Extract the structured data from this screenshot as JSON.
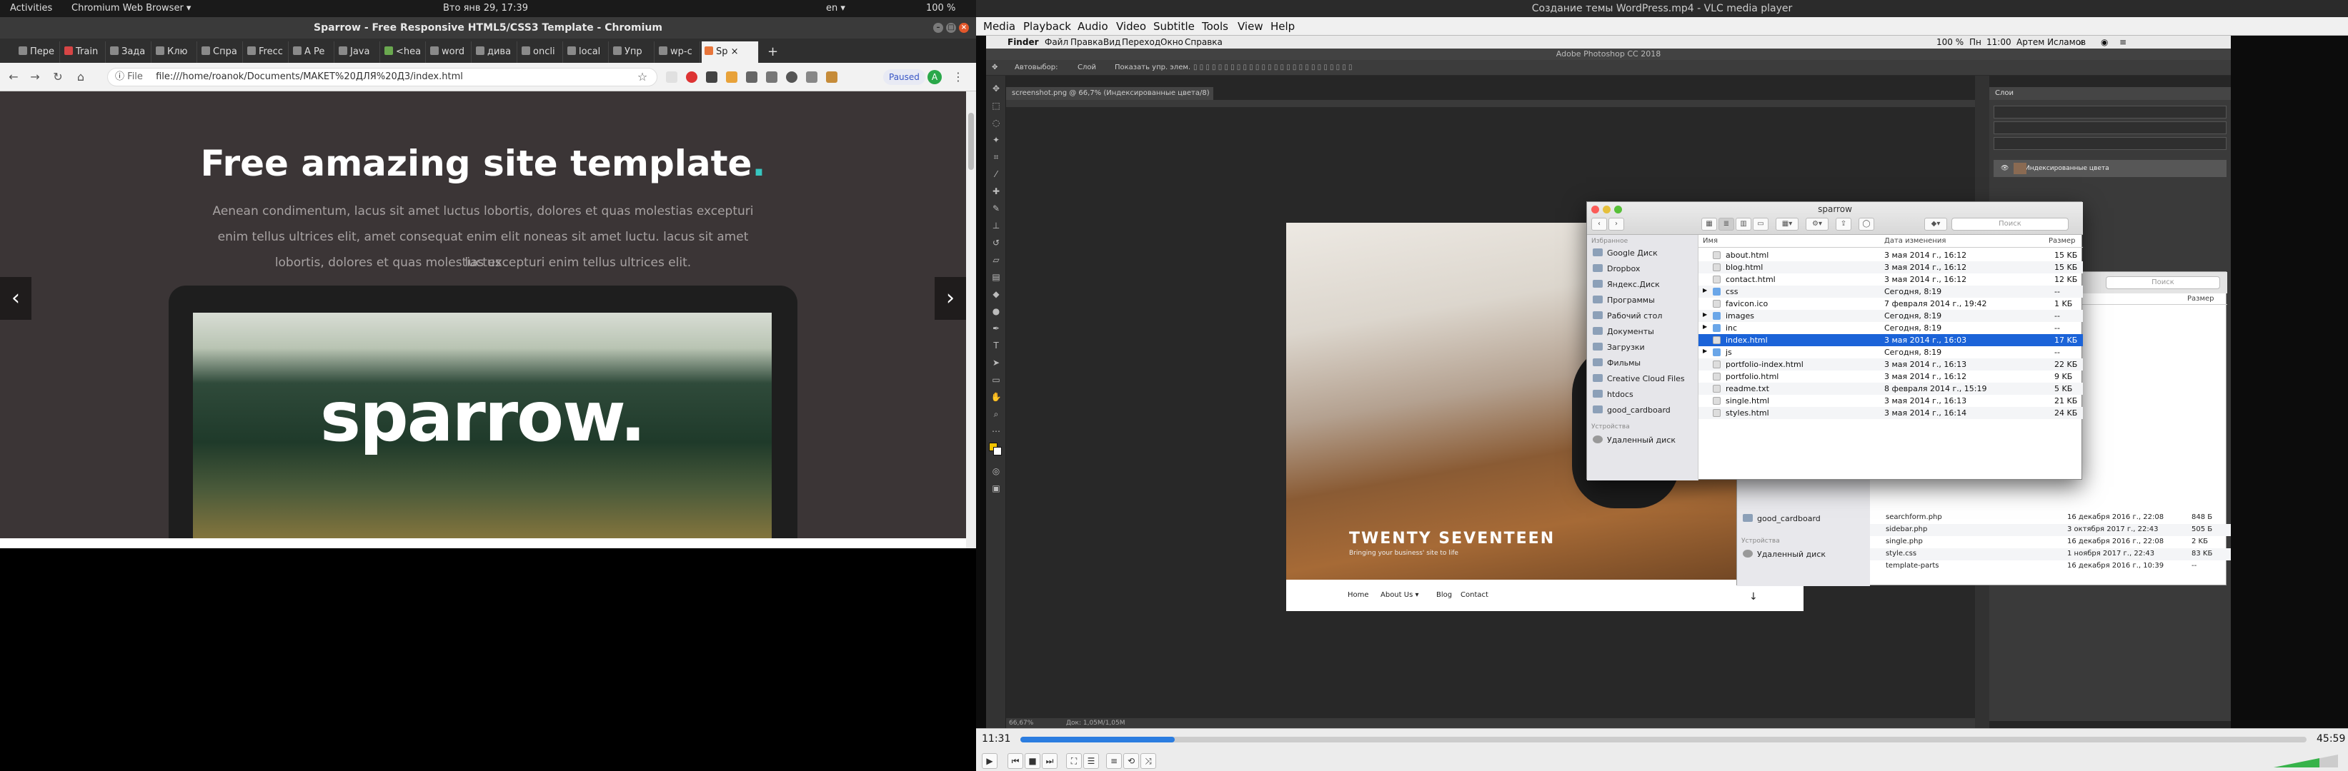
{
  "topbar": {
    "activities": "Activities",
    "app_menu": "Chromium Web Browser ▾",
    "clock": "Вто янв 29, 17:39",
    "language": "en ▾",
    "battery": "100 %"
  },
  "chromium": {
    "window_title": "Sparrow - Free Responsive HTML5/CSS3 Template - Chromium",
    "tabs": [
      "Пере",
      "Train",
      "Зада",
      "Клю",
      "Спра",
      "Frecc",
      "A Pe",
      "Java",
      "<hea",
      "word",
      "дива",
      "oncli",
      "local",
      "Упр",
      "wp-c",
      "Sp"
    ],
    "new_tab": "+",
    "url_scheme": "File",
    "url": "file:///home/roanok/Documents/MAKET%20ДЛЯ%20Д3/index.html",
    "paused_label": "Paused",
    "profile_initial": "A",
    "page": {
      "title": "Free amazing site template",
      "title_dot": ".",
      "lines": [
        "Aenean condimentum, lacus sit amet luctus lobortis, dolores et quas molestias excepturi",
        "enim tellus ultrices elit, amet consequat enim elit noneas sit amet luctu. lacus sit amet luctus",
        "lobortis, dolores et quas molestias excepturi enim tellus ultrices elit."
      ],
      "prev_arrow": "‹",
      "next_arrow": "›",
      "laptop_brand": "sparrow."
    }
  },
  "vlc": {
    "window_title": "Создание темы WordPress.mp4 - VLC media player",
    "menu": [
      "Media",
      "Playback",
      "Audio",
      "Video",
      "Subtitle",
      "Tools",
      "View",
      "Help"
    ],
    "time_current": "11:31",
    "time_total": "45:59",
    "progress_fraction": 0.12
  },
  "mac": {
    "menu": [
      "Finder",
      "Файл",
      "Правка",
      "Вид",
      "Переход",
      "Окно",
      "Справка"
    ],
    "status_right": [
      "100 %",
      "Пн",
      "11:00",
      "Артем Исламов"
    ]
  },
  "photoshop": {
    "app_title": "Adobe Photoshop CC 2018",
    "options": {
      "autoselect": "Автовыбор:",
      "layer": "Слой",
      "show_controls": "Показать упр. элем."
    },
    "doc_tab": "screenshot.png @ 66,7% (Индексированные цвета/8)",
    "layers_panel_title": "Слои",
    "layer_name": "Индексированные цвета",
    "zoom": "66,67%",
    "doc_info": "Док: 1,05M/1,05M"
  },
  "twenty_seventeen": {
    "title": "TWENTY SEVENTEEN",
    "tagline": "Bringing your business' site to life",
    "nav": [
      "Home",
      "About Us ▾",
      "Blog",
      "Contact"
    ]
  },
  "finder": {
    "title": "sparrow",
    "search_placeholder": "Поиск",
    "favorites_head": "Избранное",
    "favorites": [
      "Google Диск",
      "Dropbox",
      "Яндекс.Диск",
      "Программы",
      "Рабочий стол",
      "Документы",
      "Загрузки",
      "Фильмы",
      "Creative Cloud Files",
      "htdocs",
      "good_cardboard"
    ],
    "devices_head": "Устройства",
    "devices": [
      "Удаленный диск"
    ],
    "columns": {
      "name": "Имя",
      "date": "Дата изменения",
      "size": "Размер"
    },
    "files": [
      {
        "name": "about.html",
        "date": "3 мая 2014 г., 16:12",
        "size": "15 KБ",
        "type": "doc"
      },
      {
        "name": "blog.html",
        "date": "3 мая 2014 г., 16:12",
        "size": "15 KБ",
        "type": "doc"
      },
      {
        "name": "contact.html",
        "date": "3 мая 2014 г., 16:12",
        "size": "12 KБ",
        "type": "doc"
      },
      {
        "name": "css",
        "date": "Сегодня, 8:19",
        "size": "--",
        "type": "folder"
      },
      {
        "name": "favicon.ico",
        "date": "7 февраля 2014 г., 19:42",
        "size": "1 KБ",
        "type": "doc"
      },
      {
        "name": "images",
        "date": "Сегодня, 8:19",
        "size": "--",
        "type": "folder"
      },
      {
        "name": "inc",
        "date": "Сегодня, 8:19",
        "size": "--",
        "type": "folder"
      },
      {
        "name": "index.html",
        "date": "3 мая 2014 г., 16:03",
        "size": "17 KБ",
        "type": "doc",
        "selected": true
      },
      {
        "name": "js",
        "date": "Сегодня, 8:19",
        "size": "--",
        "type": "folder"
      },
      {
        "name": "portfolio-index.html",
        "date": "3 мая 2014 г., 16:13",
        "size": "22 KБ",
        "type": "doc"
      },
      {
        "name": "portfolio.html",
        "date": "3 мая 2014 г., 16:12",
        "size": "9 KБ",
        "type": "doc"
      },
      {
        "name": "readme.txt",
        "date": "8 февраля 2014 г., 15:19",
        "size": "5 KБ",
        "type": "doc"
      },
      {
        "name": "single.html",
        "date": "3 мая 2014 г., 16:13",
        "size": "21 KБ",
        "type": "doc"
      },
      {
        "name": "styles.html",
        "date": "3 мая 2014 г., 16:14",
        "size": "24 KБ",
        "type": "doc"
      }
    ],
    "back_window": {
      "search_placeholder": "Поиск",
      "size_head": "Размер",
      "side_item": "good_cardboard",
      "devices_head": "Устройства",
      "device": "Удаленный диск",
      "files": [
        {
          "name": "searchform.php",
          "date": "16 декабря 2016 г., 22:08",
          "size": "848 Б"
        },
        {
          "name": "sidebar.php",
          "date": "3 октября 2017 г., 22:43",
          "size": "505 Б"
        },
        {
          "name": "single.php",
          "date": "16 декабря 2016 г., 22:08",
          "size": "2 KБ"
        },
        {
          "name": "style.css",
          "date": "1 ноября 2017 г., 22:43",
          "size": "83 KБ"
        },
        {
          "name": "template-parts",
          "date": "16 декабря 2016 г., 10:39",
          "size": "--"
        }
      ]
    }
  }
}
